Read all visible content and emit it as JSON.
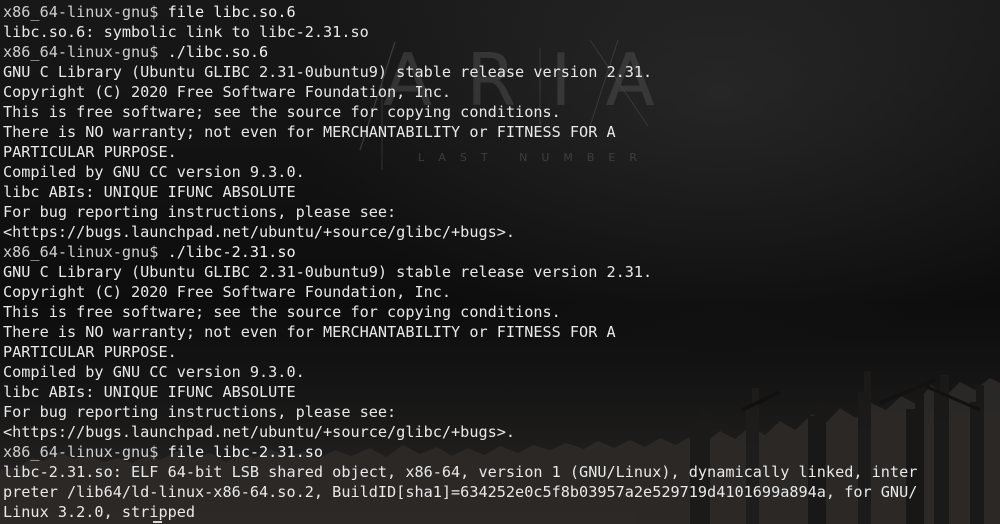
{
  "terminal": {
    "wallpaper": {
      "logo": "ARIA",
      "subtitle": "LAST NUMBER"
    },
    "lines": [
      {
        "prompt": "x86_64-linux-gnu$ ",
        "command": "file libc.so.6"
      },
      {
        "text": "libc.so.6: symbolic link to libc-2.31.so"
      },
      {
        "prompt": "x86_64-linux-gnu$ ",
        "command": "./libc.so.6"
      },
      {
        "text": "GNU C Library (Ubuntu GLIBC 2.31-0ubuntu9) stable release version 2.31."
      },
      {
        "text": "Copyright (C) 2020 Free Software Foundation, Inc."
      },
      {
        "text": "This is free software; see the source for copying conditions."
      },
      {
        "text": "There is NO warranty; not even for MERCHANTABILITY or FITNESS FOR A"
      },
      {
        "text": "PARTICULAR PURPOSE."
      },
      {
        "text": "Compiled by GNU CC version 9.3.0."
      },
      {
        "text": "libc ABIs: UNIQUE IFUNC ABSOLUTE"
      },
      {
        "text": "For bug reporting instructions, please see:"
      },
      {
        "text": "<https://bugs.launchpad.net/ubuntu/+source/glibc/+bugs>."
      },
      {
        "prompt": "x86_64-linux-gnu$ ",
        "command": "./libc-2.31.so"
      },
      {
        "text": "GNU C Library (Ubuntu GLIBC 2.31-0ubuntu9) stable release version 2.31."
      },
      {
        "text": "Copyright (C) 2020 Free Software Foundation, Inc."
      },
      {
        "text": "This is free software; see the source for copying conditions."
      },
      {
        "text": "There is NO warranty; not even for MERCHANTABILITY or FITNESS FOR A"
      },
      {
        "text": "PARTICULAR PURPOSE."
      },
      {
        "text": "Compiled by GNU CC version 9.3.0."
      },
      {
        "text": "libc ABIs: UNIQUE IFUNC ABSOLUTE"
      },
      {
        "text": "For bug reporting instructions, please see:"
      },
      {
        "text": "<https://bugs.launchpad.net/ubuntu/+source/glibc/+bugs>."
      },
      {
        "prompt": "x86_64-linux-gnu$ ",
        "command": "file libc-2.31.so"
      },
      {
        "text": "libc-2.31.so: ELF 64-bit LSB shared object, x86-64, version 1 (GNU/Linux), dynamically linked, inter"
      },
      {
        "text": "preter /lib64/ld-linux-x86-64.so.2, BuildID[sha1]=634252e0c5f8b03957a2e529719d4101699a894a, for GNU/"
      },
      {
        "text": "Linux 3.2.0, stripped"
      }
    ]
  }
}
